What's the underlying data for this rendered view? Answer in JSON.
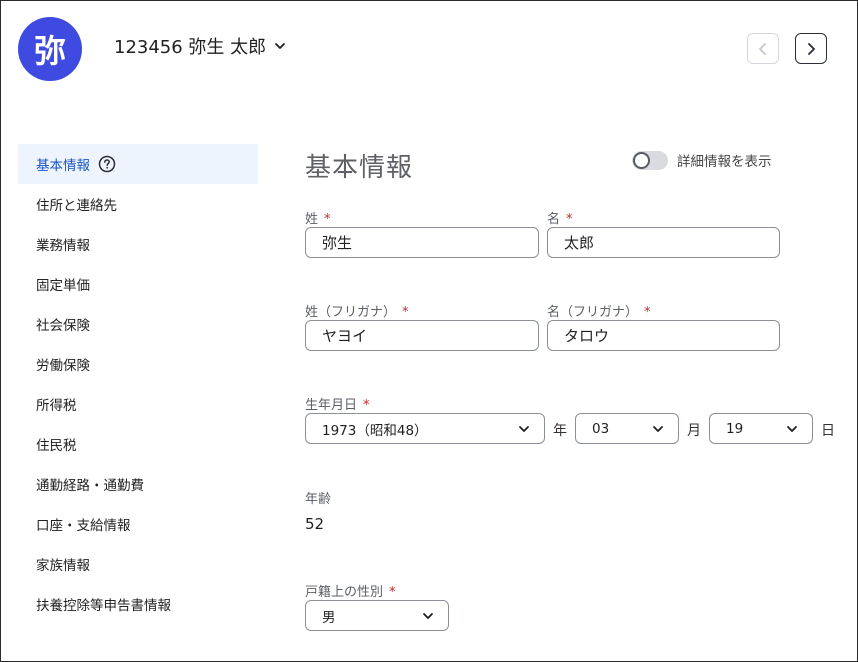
{
  "header": {
    "avatar_text": "弥",
    "employee_title": "123456 弥生 太郎",
    "prev_icon": "chevron-left-icon",
    "next_icon": "chevron-right-icon"
  },
  "sidebar": {
    "items": [
      {
        "label": "基本情報",
        "active": true
      },
      {
        "label": "住所と連絡先"
      },
      {
        "label": "業務情報"
      },
      {
        "label": "固定単価"
      },
      {
        "label": "社会保険"
      },
      {
        "label": "労働保険"
      },
      {
        "label": "所得税"
      },
      {
        "label": "住民税"
      },
      {
        "label": "通勤経路・通勤費"
      },
      {
        "label": "口座・支給情報"
      },
      {
        "label": "家族情報"
      },
      {
        "label": "扶養控除等申告書情報"
      }
    ]
  },
  "main": {
    "title": "基本情報",
    "toggle_label": "詳細情報を表示",
    "required_mark": "*",
    "last_name": {
      "label": "姓",
      "value": "弥生"
    },
    "first_name": {
      "label": "名",
      "value": "太郎"
    },
    "last_name_kana": {
      "label": "姓（フリガナ）",
      "value": "ヤヨイ"
    },
    "first_name_kana": {
      "label": "名（フリガナ）",
      "value": "タロウ"
    },
    "birthdate": {
      "label": "生年月日",
      "year": "1973（昭和48）",
      "year_unit": "年",
      "month": "03",
      "month_unit": "月",
      "day": "19",
      "day_unit": "日"
    },
    "age": {
      "label": "年齢",
      "value": "52"
    },
    "gender": {
      "label": "戸籍上の性別",
      "value": "男"
    }
  },
  "colors": {
    "accent": "#3f4ae0",
    "active_bg": "#eef4fd",
    "active_text": "#1a56c4",
    "required": "#c62828"
  }
}
